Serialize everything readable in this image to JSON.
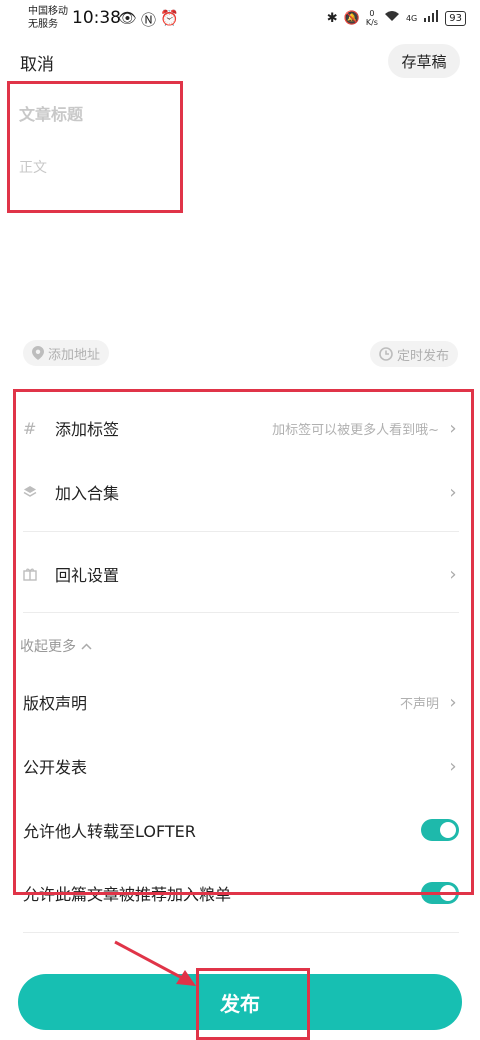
{
  "status_bar": {
    "carrier_line1": "中国移动",
    "carrier_line2": "无服务",
    "time": "10:38",
    "speed_value": "0",
    "speed_unit": "K/s",
    "network": "4G",
    "battery": "93"
  },
  "header": {
    "cancel_label": "取消",
    "draft_label": "存草稿"
  },
  "editor": {
    "title_placeholder": "文章标题",
    "body_placeholder": "正文"
  },
  "chips": {
    "location_label": "添加地址",
    "schedule_label": "定时发布"
  },
  "settings": {
    "tags_label": "添加标签",
    "tags_hint": "加标签可以被更多人看到哦~",
    "collection_label": "加入合集",
    "gift_label": "回礼设置",
    "collapse_label": "收起更多",
    "copyright_label": "版权声明",
    "copyright_value": "不声明",
    "visibility_label": "公开发表",
    "allow_repost_label": "允许他人转载至LOFTER",
    "allow_repost_on": true,
    "allow_recommend_label": "允许此篇文章被推荐加入粮单",
    "allow_recommend_on": true
  },
  "publish": {
    "label": "发布"
  },
  "colors": {
    "accent": "#17bfb2",
    "annotation": "#e03448"
  }
}
